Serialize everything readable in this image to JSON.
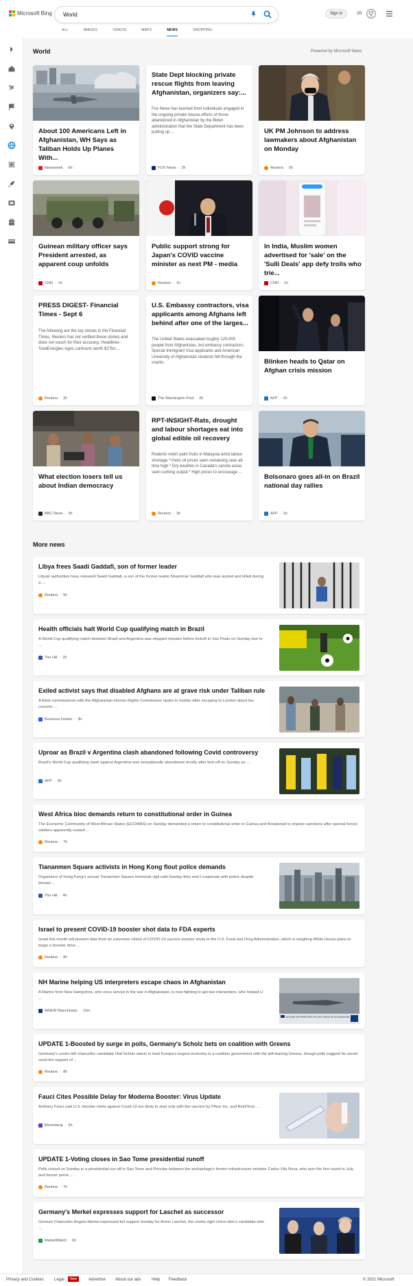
{
  "brand": {
    "name": "Microsoft Bing",
    "colors": [
      "#f25022",
      "#7fba00",
      "#00a4ef",
      "#ffb900"
    ]
  },
  "search": {
    "value": "World"
  },
  "header": {
    "sign_in": "Sign in",
    "rewards_count": "20"
  },
  "tabs": [
    {
      "label": "ALL"
    },
    {
      "label": "IMAGES"
    },
    {
      "label": "VIDEOS"
    },
    {
      "label": "MAPS"
    },
    {
      "label": "NEWS",
      "active": true
    },
    {
      "label": "SHOPPING"
    }
  ],
  "sidebar": {
    "icons": [
      "chevron-right-icon",
      "home-icon",
      "us-icon",
      "flag-icon",
      "pin-icon",
      "globe-icon",
      "science-icon",
      "rocket-icon",
      "entertainment-icon",
      "business-icon",
      "money-icon"
    ]
  },
  "main": {
    "section_title": "World",
    "powered_by": "Powered by Microsoft News"
  },
  "cards": [
    {
      "title": "About 100 Americans Left in Afghanistan, WH Says as Taliban Holds Up Planes With...",
      "source": "Newsweek",
      "time": "6h"
    },
    {
      "title": "State Dept blocking private rescue flights from leaving Afghanistan, organizers say:...",
      "snippet": "Fox News has learned from individuals engaged in the ongoing private rescue efforts of those abandoned in Afghanistan by the Biden administration that the State Department has been putting up ...",
      "source": "FOX News",
      "time": "2h"
    },
    {
      "title": "UK PM Johnson to address lawmakers about Afghanistan on Monday",
      "source": "Reuters",
      "time": "5h"
    },
    {
      "title": "Guinean military officer says President arrested, as apparent coup unfolds",
      "source": "CNN",
      "time": "1h"
    },
    {
      "title": "Public support strong for Japan's COVID vaccine minister as next PM - media",
      "source": "Reuters",
      "time": "1h"
    },
    {
      "title": "In India, Muslim women advertised for 'sale' on the 'Sulli Deals' app defy trolls who trie...",
      "source": "CNN",
      "time": "1h"
    },
    {
      "title": "PRESS DIGEST- Financial Times - Sept 6",
      "snippet": "The following are the top stories in the Financial Times. Reuters has not verified these stories and does not vouch for their accuracy. Headlines - TotalEnergies signs contracts worth $27bn ...",
      "source": "Reuters",
      "time": "2h"
    },
    {
      "title": "U.S. Embassy contractors, visa applicants among Afghans left behind after one of the larges...",
      "snippet": "The United States evacuated roughly 120,000 people from Afghanistan, but embassy contractors, Special Immigrant Visa applicants and American University of Afghanistan students fell through the cracks.",
      "source": "The Washington Post",
      "time": "2h"
    },
    {
      "title": "Blinken heads to Qatar on Afghan crisis mission",
      "source": "AFP",
      "time": "2h"
    },
    {
      "title": "What election losers tell us about Indian democracy",
      "source": "BBC News",
      "time": "3h"
    },
    {
      "title": "RPT-INSIGHT-Rats, drought and labour shortages eat into global edible oil recovery",
      "snippet": "Rodents relish palm fruits in Malaysia amid labour shortage * Palm oil prices seen remaining near all-time high * Dry weather in Canada's canola areas seen curbing output * High prices to encourage ...",
      "source": "Reuters",
      "time": "3h"
    },
    {
      "title": "Bolsonaro goes all-in on Brazil national day rallies",
      "source": "AFP",
      "time": "1h"
    }
  ],
  "more_news": {
    "title": "More news",
    "items": [
      {
        "title": "Libya frees Saadi Gaddafi, son of former leader",
        "snippet": "Libyan authorities have released Saadi Gaddafi, a son of the former leader Muammar Gaddafi who was ousted and killed during a ...",
        "source": "Reuters",
        "time": "5h"
      },
      {
        "title": "Health officials halt World Cup qualifying match in Brazil",
        "snippet": "A World Cup qualifying match between Brazil and Argentina was stopped minutes before kickoff in Sao Paulo on Sunday due to ...",
        "source": "The Hill",
        "time": "2h"
      },
      {
        "title": "Exiled activist says that disabled Afghans are at grave risk under Taliban rule",
        "snippet": "A blind commissioner with the Afghanistan Human Rights Commission spoke to Insider after escaping to London about her concern ...",
        "source": "Business Insider",
        "time": "3h"
      },
      {
        "title": "Uproar as Brazil v Argentina clash abandoned following Covid controversy",
        "snippet": "Brazil's World Cup qualifying clash against Argentina was sensationally abandoned shortly after kick-off on Sunday as ...",
        "source": "AFP",
        "time": "3h"
      },
      {
        "title": "West Africa bloc demands return to constitutional order in Guinea",
        "snippet": "The Economic Community of West African States (ECOWAS) on Sunday demanded a return to constitutional order in Guinea and threatened to impose sanctions after special forces soldiers apparently ousted ...",
        "source": "Reuters",
        "time": "7h"
      },
      {
        "title": "Tiananmen Square activists in Hong Kong flout police demands",
        "snippet": "Organizers of Hong Kong's annual Tiananmen Square memorial vigil said Sunday they won't cooperate with police despite threats ...",
        "source": "The Hill",
        "time": "4h"
      },
      {
        "title": "Israel to present COVID-19 booster shot data to FDA experts",
        "snippet": "Israel this month will present data from an extensive rollout of COVID-19 vaccine booster shots to the U.S. Food and Drug Administration, which is weighing White House plans to begin a booster drive ...",
        "source": "Reuters",
        "time": "8h"
      },
      {
        "title": "NH Marine helping US interpreters escape chaos in Afghanistan",
        "snippet": "A Marine from New Hampshire, who once served in the war in Afghanistan, is now fighting to get two interpreters, who helped U ...",
        "source": "WMUR Manchester",
        "time": "10m"
      },
      {
        "title": "UPDATE 1-Boosted by surge in polls, Germany's Scholz bets on coalition with Greens",
        "snippet": "Germany's center-left chancellor candidate Olaf Scholz wants to lead Europe's largest economy in a coalition government with the left-leaning Greens, though polls suggest he would need the support of ...",
        "source": "Reuters",
        "time": "8h"
      },
      {
        "title": "Fauci Cites Possible Delay for Moderna Booster: Virus Update",
        "snippet": "Anthony Fauci said U.S. booster shots against Covid-19 are likely to start only with the vaccine by Pfizer Inc. and BioNTech ...",
        "source": "Bloomberg",
        "time": "5h"
      },
      {
        "title": "UPDATE 1-Voting closes in Sao Tome presidential runoff",
        "snippet": "Polls closed on Sunday in a presidential run-off in Sao Tome and Principe between the archipelago's former infrastructure minister Carlos Vila Nova, who won the first round in July, and former prime ...",
        "source": "Reuters",
        "time": "7h"
      },
      {
        "title": "Germany's Merkel expresses support for Laschet as successor",
        "snippet": "German Chancellor Angela Merkel expressed full support Sunday for Armin Laschet, the center-right Union bloc's candidate who ...",
        "source": "MarketWatch",
        "time": "6h"
      }
    ]
  },
  "thumb_captions": {
    "nh_marine": "AFGHAN INTERPRETERS ESCAPE CHAOS IN AFGHANISTAN"
  },
  "footer": {
    "links": [
      "Privacy and Cookies",
      "Legal",
      "Advertise",
      "About our ads",
      "Help",
      "Feedback"
    ],
    "new_badge": "New",
    "copyright": "© 2021 Microsoft"
  }
}
